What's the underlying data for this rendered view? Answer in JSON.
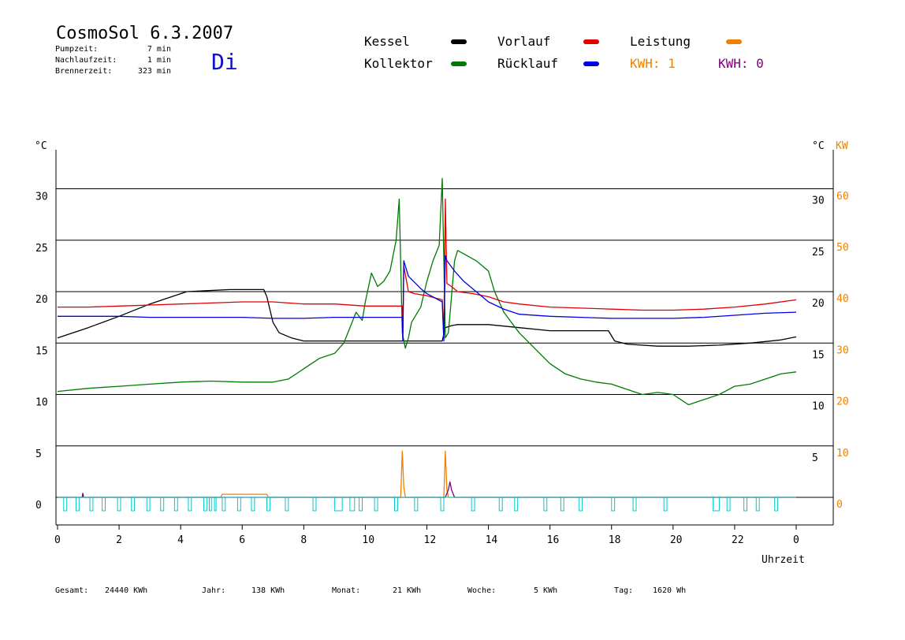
{
  "header": {
    "title": "CosmoSol 6.3.2007",
    "day": "Di",
    "pump_label": "Pumpzeit:",
    "pump_value": "7 min",
    "nachlauf_label": "Nachlaufzeit:",
    "nachlauf_value": "1 min",
    "brenner_label": "Brennerzeit:",
    "brenner_value": "323 min"
  },
  "legend": {
    "kessel": "Kessel",
    "kollektor": "Kollektor",
    "vorlauf": "Vorlauf",
    "ruecklauf": "Rücklauf",
    "leistung": "Leistung",
    "kwh1": "KWH: 1",
    "kwh2": "KWH: 0"
  },
  "colors": {
    "kessel": "#000000",
    "kollektor": "#007a00",
    "vorlauf": "#e00000",
    "ruecklauf": "#0000e0",
    "leistung": "#f08000",
    "kwh2": "#800080",
    "pump": "#00c8c8"
  },
  "footer": {
    "gesamt_label": "Gesamt:",
    "gesamt_value": "24440 KWh",
    "jahr_label": "Jahr:",
    "jahr_value": "138 KWh",
    "monat_label": "Monat:",
    "monat_value": "21 KWh",
    "woche_label": "Woche:",
    "woche_value": "5 KWh",
    "tag_label": "Tag:",
    "tag_value": "1620 Wh"
  },
  "chart_data": {
    "type": "line",
    "xlabel": "Uhrzeit",
    "ylabel_left": "°C",
    "ylabel_right": "°C",
    "ylabel_right2": "KW",
    "xlim": [
      0,
      24
    ],
    "ylim": [
      -2,
      35
    ],
    "x_ticks": [
      0,
      2,
      4,
      6,
      8,
      10,
      12,
      14,
      16,
      18,
      20,
      22,
      24
    ],
    "x_tick_labels": [
      "0",
      "2",
      "4",
      "6",
      "8",
      "10",
      "12",
      "14",
      "16",
      "18",
      "20",
      "22",
      "0"
    ],
    "y_ticks": [
      0,
      5,
      10,
      15,
      20,
      25,
      30
    ],
    "y_tick_labels_left": [
      "0",
      "5",
      "10",
      "15",
      "20",
      "25",
      "30"
    ],
    "y_tick_labels_right": [
      "5",
      "10",
      "15",
      "20",
      "25",
      "30"
    ],
    "y2_tick_labels": [
      "0",
      "10",
      "20",
      "30",
      "40",
      "50",
      "60"
    ],
    "grid": true,
    "series": [
      {
        "name": "Kessel",
        "color": "#000000",
        "x": [
          0,
          1,
          2,
          3,
          4.2,
          5.6,
          6.7,
          6.8,
          7.0,
          7.2,
          7.6,
          8.0,
          9.0,
          10.0,
          11.2,
          11.22,
          12.5,
          12.6,
          12.8,
          13.0,
          14.0,
          15.0,
          16.0,
          17.0,
          17.9,
          18.1,
          18.5,
          19.5,
          20.5,
          21.5,
          22.5,
          23.5,
          24.0
        ],
        "y": [
          15.5,
          16.5,
          17.6,
          18.8,
          20.0,
          20.2,
          20.2,
          19.5,
          17.0,
          16.0,
          15.5,
          15.2,
          15.2,
          15.2,
          15.2,
          15.2,
          15.2,
          16.5,
          16.7,
          16.8,
          16.8,
          16.5,
          16.2,
          16.2,
          16.2,
          15.2,
          14.9,
          14.7,
          14.7,
          14.8,
          15.0,
          15.3,
          15.6
        ]
      },
      {
        "name": "Kollektor",
        "color": "#007a00",
        "x": [
          0,
          1,
          2,
          3,
          4,
          5,
          6,
          7,
          7.5,
          8,
          8.5,
          9,
          9.3,
          9.5,
          9.7,
          9.9,
          10.0,
          10.2,
          10.4,
          10.6,
          10.8,
          11.0,
          11.1,
          11.2,
          11.3,
          11.4,
          11.5,
          11.8,
          12.0,
          12.2,
          12.4,
          12.5,
          12.6,
          12.7,
          12.9,
          13.0,
          13.3,
          13.6,
          14.0,
          14.2,
          14.5,
          15.0,
          15.5,
          16.0,
          16.5,
          17.0,
          17.5,
          18.0,
          18.5,
          19.0,
          19.5,
          20.0,
          20.5,
          21.0,
          21.5,
          22.0,
          22.5,
          23.0,
          23.5,
          24.0
        ],
        "y": [
          10.3,
          10.6,
          10.8,
          11.0,
          11.2,
          11.3,
          11.2,
          11.2,
          11.5,
          12.5,
          13.5,
          14.0,
          15.0,
          16.5,
          18.0,
          17.2,
          19.0,
          21.8,
          20.5,
          21.0,
          22.0,
          25.0,
          29.0,
          16.0,
          14.5,
          15.5,
          17.0,
          18.5,
          21.0,
          23.0,
          24.5,
          31.0,
          15.5,
          16.0,
          23.0,
          24.0,
          23.5,
          23.0,
          22.0,
          20.0,
          18.0,
          16.0,
          14.5,
          13.0,
          12.0,
          11.5,
          11.2,
          11.0,
          10.5,
          10.0,
          10.2,
          10.0,
          9.0,
          9.5,
          10.0,
          10.8,
          11.0,
          11.5,
          12.0,
          12.2
        ]
      },
      {
        "name": "Vorlauf",
        "color": "#e00000",
        "x": [
          0,
          1,
          2,
          3,
          4,
          5,
          6,
          7,
          8,
          9,
          10,
          11.0,
          11.2,
          11.22,
          11.25,
          11.4,
          11.6,
          12.0,
          12.5,
          12.55,
          12.6,
          12.65,
          12.8,
          13.0,
          13.5,
          14.0,
          14.5,
          15.0,
          16.0,
          17.0,
          18.0,
          19.0,
          20.0,
          21.0,
          22.0,
          23.0,
          24.0
        ],
        "y": [
          18.5,
          18.5,
          18.6,
          18.7,
          18.8,
          18.9,
          19.0,
          19.0,
          18.8,
          18.8,
          18.6,
          18.6,
          18.6,
          15.5,
          22.5,
          20.0,
          19.8,
          19.6,
          19.2,
          15.5,
          29.0,
          20.8,
          20.5,
          20.0,
          19.8,
          19.5,
          19.0,
          18.8,
          18.5,
          18.4,
          18.3,
          18.2,
          18.2,
          18.3,
          18.5,
          18.8,
          19.2
        ]
      },
      {
        "name": "Rücklauf",
        "color": "#0000e0",
        "x": [
          0,
          1,
          2,
          3,
          4,
          5,
          6,
          7,
          8,
          9,
          10,
          11.0,
          11.2,
          11.22,
          11.25,
          11.4,
          11.8,
          12.0,
          12.5,
          12.55,
          12.6,
          12.65,
          12.9,
          13.2,
          13.6,
          14.0,
          14.5,
          15.0,
          16.0,
          17.0,
          18.0,
          19.0,
          20.0,
          21.0,
          22.0,
          23.0,
          24.0
        ],
        "y": [
          17.6,
          17.6,
          17.6,
          17.5,
          17.5,
          17.5,
          17.5,
          17.4,
          17.4,
          17.5,
          17.5,
          17.5,
          17.5,
          15.2,
          23.0,
          21.5,
          20.3,
          19.8,
          19.0,
          15.2,
          23.5,
          23.0,
          22.0,
          21.0,
          20.0,
          19.0,
          18.3,
          17.8,
          17.6,
          17.5,
          17.4,
          17.4,
          17.4,
          17.5,
          17.7,
          17.9,
          18.0
        ]
      },
      {
        "name": "Leistung",
        "color": "#f08000",
        "axis": "KW",
        "x": [
          0,
          5.3,
          5.35,
          6.8,
          6.85,
          11.15,
          11.2,
          11.25,
          11.3,
          12.55,
          12.6,
          12.65,
          12.7,
          24.0
        ],
        "y": [
          0,
          0,
          0.6,
          0.6,
          0,
          0,
          9.0,
          2.0,
          0,
          0,
          9.0,
          1.5,
          0,
          0
        ]
      },
      {
        "name": "KWH: 0",
        "color": "#800080",
        "axis": "KW",
        "x": [
          0,
          0.8,
          0.82,
          0.85,
          12.6,
          12.7,
          12.75,
          12.8,
          12.9,
          24.0
        ],
        "y": [
          0,
          0,
          0.8,
          0,
          0,
          1.5,
          3.0,
          1.5,
          0,
          0
        ]
      }
    ],
    "pump_intervals": [
      [
        0.2,
        0.3
      ],
      [
        0.6,
        0.7
      ],
      [
        1.05,
        1.15
      ],
      [
        1.45,
        1.55
      ],
      [
        1.95,
        2.05
      ],
      [
        2.4,
        2.5
      ],
      [
        2.9,
        3.0
      ],
      [
        3.35,
        3.45
      ],
      [
        3.8,
        3.9
      ],
      [
        4.25,
        4.35
      ],
      [
        4.75,
        4.85
      ],
      [
        4.93,
        5.0
      ],
      [
        5.1,
        5.15
      ],
      [
        5.35,
        5.45
      ],
      [
        5.85,
        5.95
      ],
      [
        6.3,
        6.4
      ],
      [
        6.8,
        6.9
      ],
      [
        7.4,
        7.5
      ],
      [
        8.3,
        8.4
      ],
      [
        9.0,
        9.25
      ],
      [
        9.5,
        9.65
      ],
      [
        9.8,
        9.9
      ],
      [
        10.3,
        10.4
      ],
      [
        10.95,
        11.05
      ],
      [
        11.6,
        11.7
      ],
      [
        12.45,
        12.55
      ],
      [
        13.45,
        13.55
      ],
      [
        14.35,
        14.45
      ],
      [
        14.85,
        14.95
      ],
      [
        15.8,
        15.9
      ],
      [
        16.35,
        16.45
      ],
      [
        16.95,
        17.05
      ],
      [
        18.0,
        18.1
      ],
      [
        18.7,
        18.8
      ],
      [
        19.7,
        19.8
      ],
      [
        21.3,
        21.5
      ],
      [
        21.75,
        21.85
      ],
      [
        22.3,
        22.4
      ],
      [
        22.7,
        22.8
      ],
      [
        23.3,
        23.4
      ]
    ]
  }
}
